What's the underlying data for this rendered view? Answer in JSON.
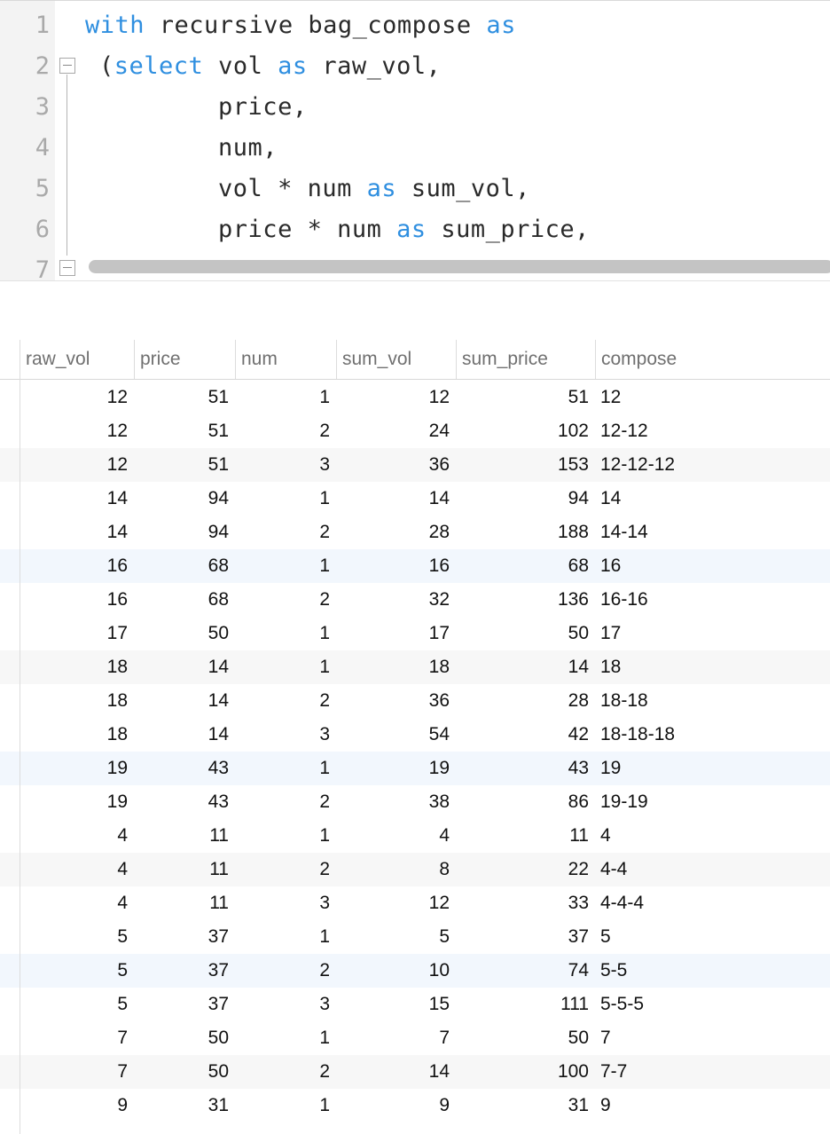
{
  "editor": {
    "lines": [
      {
        "n": "1",
        "tokens": [
          {
            "t": "with",
            "kw": true
          },
          {
            "t": " recursive bag_compose "
          },
          {
            "t": "as",
            "kw": true
          }
        ]
      },
      {
        "n": "2",
        "tokens": [
          {
            "t": "("
          },
          {
            "t": "select",
            "kw": true
          },
          {
            "t": " vol "
          },
          {
            "t": "as",
            "kw": true
          },
          {
            "t": " raw_vol,"
          }
        ]
      },
      {
        "n": "3",
        "tokens": [
          {
            "t": "        price,"
          }
        ]
      },
      {
        "n": "4",
        "tokens": [
          {
            "t": "        num,"
          }
        ]
      },
      {
        "n": "5",
        "tokens": [
          {
            "t": "        vol * num "
          },
          {
            "t": "as",
            "kw": true
          },
          {
            "t": " sum_vol,"
          }
        ]
      },
      {
        "n": "6",
        "tokens": [
          {
            "t": "        price * num "
          },
          {
            "t": "as",
            "kw": true
          },
          {
            "t": " sum_price,"
          }
        ]
      },
      {
        "n": "7",
        "tokens": []
      }
    ]
  },
  "results": {
    "columns": [
      "raw_vol",
      "price",
      "num",
      "sum_vol",
      "sum_price",
      "compose"
    ],
    "rows": [
      [
        "12",
        "51",
        "1",
        "12",
        "51",
        "12"
      ],
      [
        "12",
        "51",
        "2",
        "24",
        "102",
        "12-12"
      ],
      [
        "12",
        "51",
        "3",
        "36",
        "153",
        "12-12-12"
      ],
      [
        "14",
        "94",
        "1",
        "14",
        "94",
        "14"
      ],
      [
        "14",
        "94",
        "2",
        "28",
        "188",
        "14-14"
      ],
      [
        "16",
        "68",
        "1",
        "16",
        "68",
        "16"
      ],
      [
        "16",
        "68",
        "2",
        "32",
        "136",
        "16-16"
      ],
      [
        "17",
        "50",
        "1",
        "17",
        "50",
        "17"
      ],
      [
        "18",
        "14",
        "1",
        "18",
        "14",
        "18"
      ],
      [
        "18",
        "14",
        "2",
        "36",
        "28",
        "18-18"
      ],
      [
        "18",
        "14",
        "3",
        "54",
        "42",
        "18-18-18"
      ],
      [
        "19",
        "43",
        "1",
        "19",
        "43",
        "19"
      ],
      [
        "19",
        "43",
        "2",
        "38",
        "86",
        "19-19"
      ],
      [
        "4",
        "11",
        "1",
        "4",
        "11",
        "4"
      ],
      [
        "4",
        "11",
        "2",
        "8",
        "22",
        "4-4"
      ],
      [
        "4",
        "11",
        "3",
        "12",
        "33",
        "4-4-4"
      ],
      [
        "5",
        "37",
        "1",
        "5",
        "37",
        "5"
      ],
      [
        "5",
        "37",
        "2",
        "10",
        "74",
        "5-5"
      ],
      [
        "5",
        "37",
        "3",
        "15",
        "111",
        "5-5-5"
      ],
      [
        "7",
        "50",
        "1",
        "7",
        "50",
        "7"
      ],
      [
        "7",
        "50",
        "2",
        "14",
        "100",
        "7-7"
      ],
      [
        "9",
        "31",
        "1",
        "9",
        "31",
        "9"
      ]
    ]
  }
}
